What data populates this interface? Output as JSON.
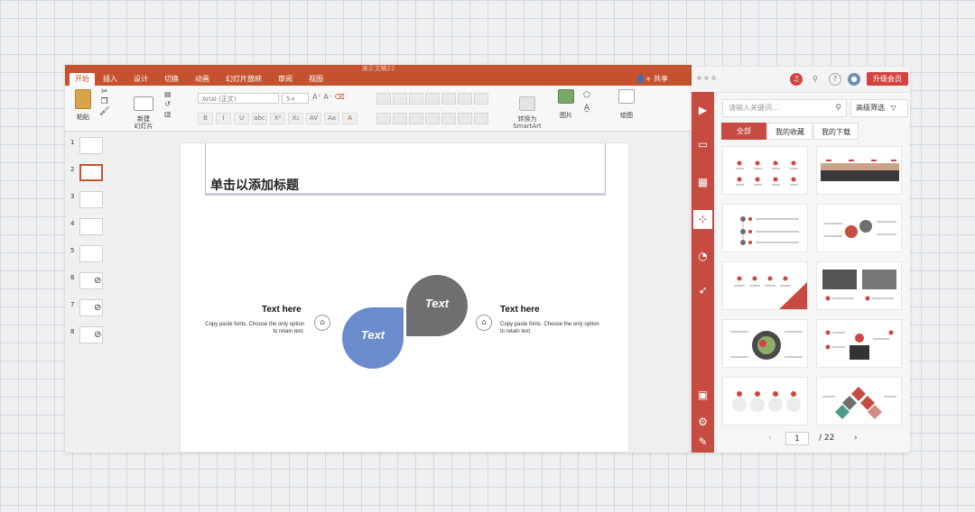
{
  "ppt": {
    "window_title": "演示文稿22",
    "tabs": [
      "开始",
      "插入",
      "设计",
      "切换",
      "动画",
      "幻灯片放映",
      "审阅",
      "视图"
    ],
    "share_label": "共享",
    "toolbar": {
      "paste_label": "粘贴",
      "new_slide_label": "新建\n幻灯片",
      "font_name": "Arial (正文)",
      "font_size": "5+",
      "convert_label": "转换为\nSmartArt",
      "picture_label": "图片",
      "drawing_label": "绘图"
    },
    "thumbnails": [
      {
        "num": "1",
        "hidden": false
      },
      {
        "num": "2",
        "hidden": false,
        "selected": true
      },
      {
        "num": "3",
        "hidden": false
      },
      {
        "num": "4",
        "hidden": false
      },
      {
        "num": "5",
        "hidden": false
      },
      {
        "num": "6",
        "hidden": true
      },
      {
        "num": "7",
        "hidden": true
      },
      {
        "num": "8",
        "hidden": true
      }
    ],
    "slide": {
      "title": "单击以添加标题",
      "left_box": {
        "title": "Text here",
        "body": "Copy paste fonts. Choose the only option to retain text."
      },
      "right_box": {
        "title": "Text here",
        "body": "Copy paste fonts. Choose the only option to retain text."
      },
      "petal_blue_text": "Text",
      "petal_gray_text": "Text",
      "colors": {
        "blue": "#6b8ccc",
        "gray": "#6f6f6f"
      }
    }
  },
  "plugin": {
    "upgrade_label": "升级会员",
    "search_placeholder": "请输入关键词...",
    "filter_label": "高级筛选",
    "tabs": [
      "全部",
      "我的收藏",
      "我的下载"
    ],
    "pager": {
      "current": "1",
      "total": "/ 22"
    },
    "accent": "#c64c42"
  }
}
